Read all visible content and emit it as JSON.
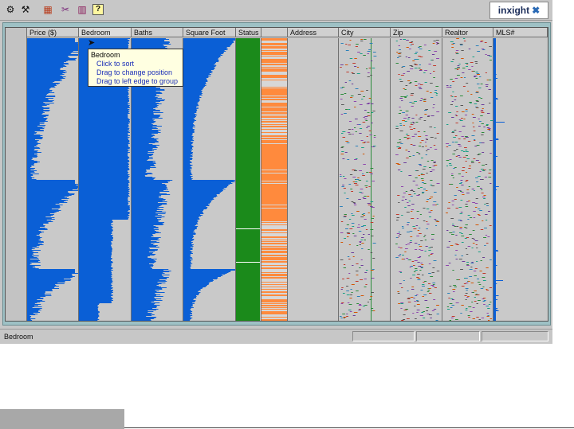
{
  "toolbar": {
    "buttons": [
      {
        "icon": "settings-icon",
        "glyph": "⚙"
      },
      {
        "icon": "hammer-icon",
        "glyph": "⚒"
      },
      {
        "icon": "table-icon",
        "glyph": "▦"
      },
      {
        "icon": "filter-icon",
        "glyph": "✂"
      },
      {
        "icon": "column-icon",
        "glyph": "▥"
      },
      {
        "icon": "help-icon",
        "glyph": "?"
      }
    ],
    "logo": {
      "text": "inxight",
      "mark": "✖"
    }
  },
  "table": {
    "columns": [
      {
        "label": "Price ($)",
        "type": "bar"
      },
      {
        "label": "Bedroom",
        "type": "bar"
      },
      {
        "label": "Baths",
        "type": "bar"
      },
      {
        "label": "Square Foot",
        "type": "bar"
      },
      {
        "label": "Status",
        "type": "category"
      },
      {
        "label": "",
        "type": "category"
      },
      {
        "label": "Address",
        "type": "text"
      },
      {
        "label": "City",
        "type": "text"
      },
      {
        "label": "Zip",
        "type": "text"
      },
      {
        "label": "Realtor",
        "type": "text"
      },
      {
        "label": "MLS#",
        "type": "bar"
      }
    ],
    "colors": {
      "bar": "#0a5fd6",
      "status_green": "#1b8a1b",
      "status_orange": "#ff8a3d"
    }
  },
  "tooltip": {
    "title": "Bedroom",
    "items": [
      "Click to sort",
      "Drag to change position",
      "Drag to left edge to group"
    ]
  },
  "statusbar": {
    "text": "Bedroom"
  }
}
